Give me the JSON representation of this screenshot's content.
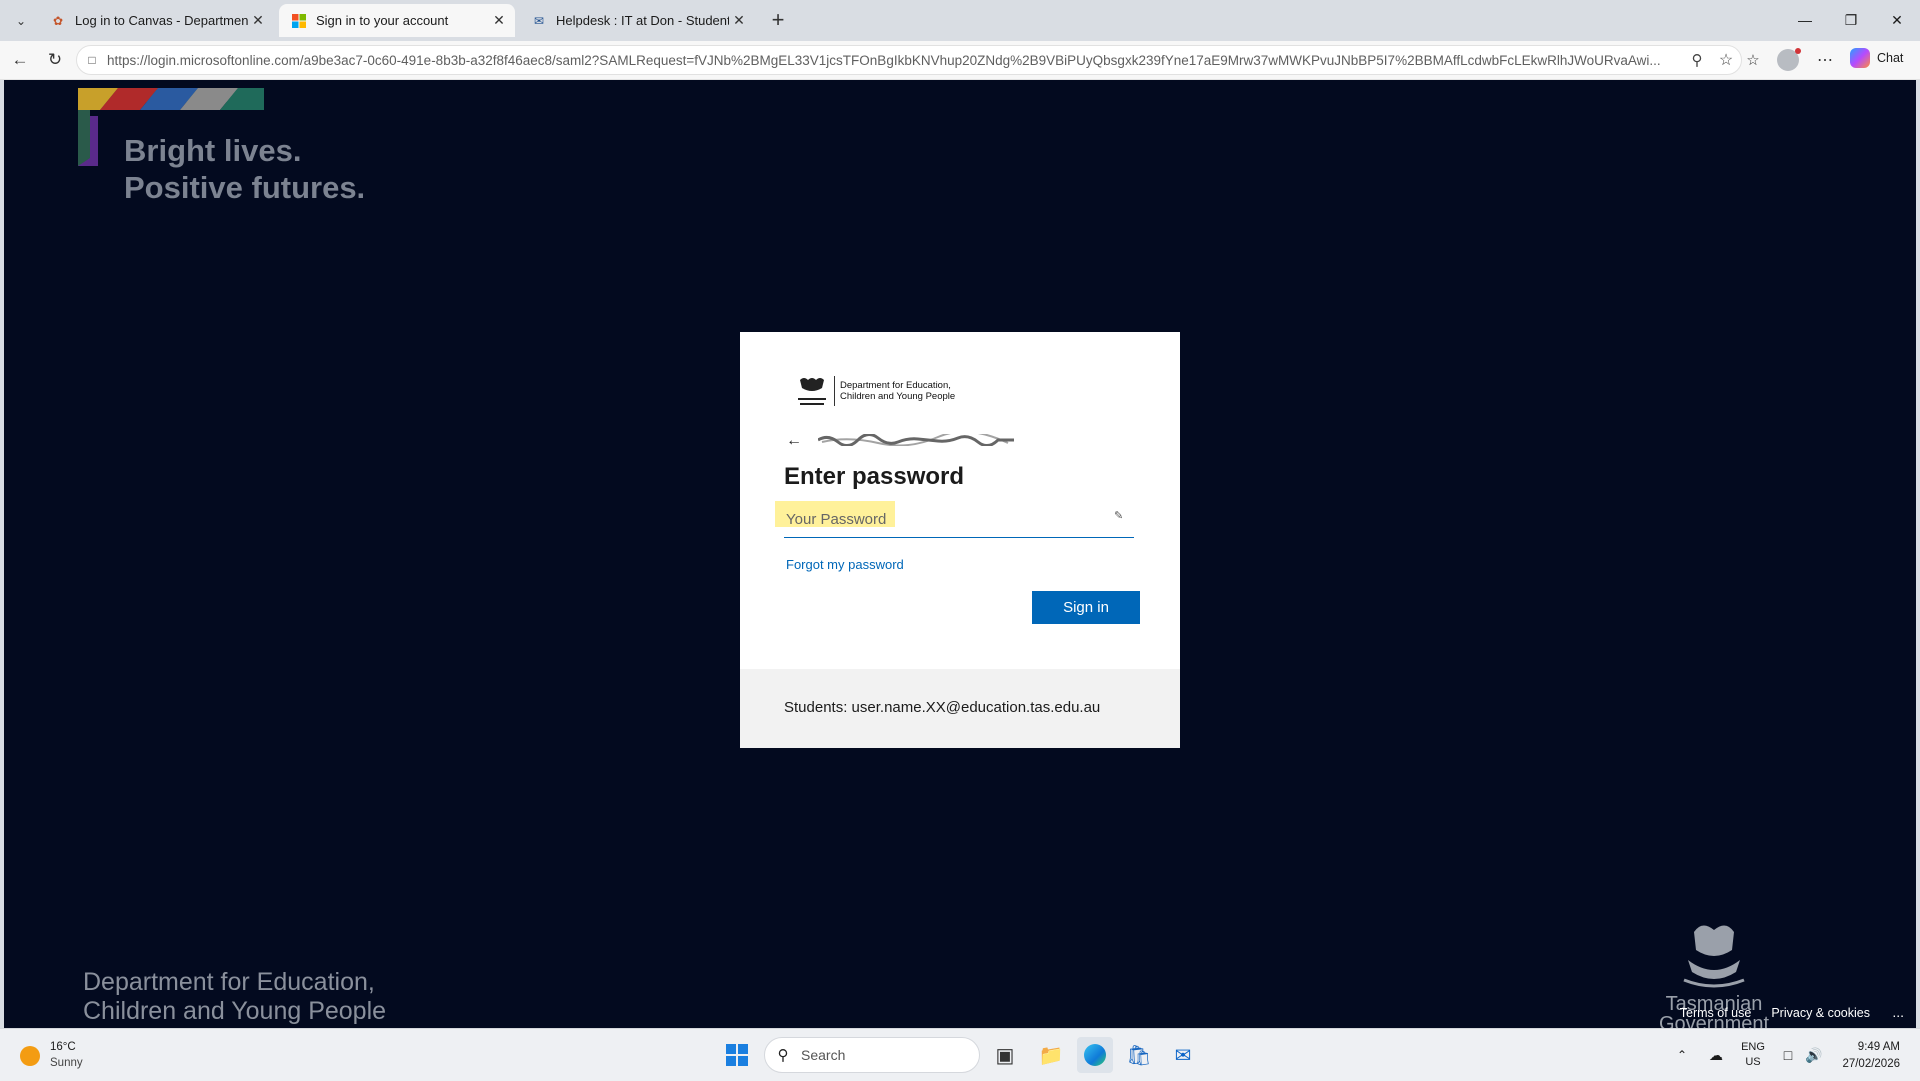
{
  "browser": {
    "tabs": [
      {
        "title": "Log in to Canvas - Department for Education, Children and Young People",
        "active": false
      },
      {
        "title": "Sign in to your account",
        "active": true
      },
      {
        "title": "Helpdesk : IT at Don - Student Operations",
        "active": false
      }
    ],
    "url": "https://login.microsoftonline.com/a9be3ac7-0c60-491e-8b3b-a32f8f46aec8/saml2?SAMLRequest=fVJNb%2BMgEL33V1jcsTFOnBgIkbKNVhup20ZNdg%2B9VBiPUyQbsgxk239fYne17aE9Mrw37wMWKPvuJNbBP5I7%2BBMAffLcdwbFcLEkwRlhJWoURvaAwi...",
    "chat_label": "Chat"
  },
  "page": {
    "tagline_line1": "Bright lives.",
    "tagline_line2": "Positive futures.",
    "dept_line1": "Department for Education,",
    "dept_line2": "Children and Young People",
    "tas_gov_line1": "Tasmanian",
    "tas_gov_line2": "Government",
    "footer": {
      "terms": "Terms of use",
      "privacy": "Privacy & cookies",
      "more": "..."
    }
  },
  "signin_card": {
    "org_line1": "Department for Education,",
    "org_line2": "Children and Young People",
    "heading": "Enter password",
    "password_placeholder": "Your Password",
    "forgot_link": "Forgot my password",
    "signin_button": "Sign in",
    "students_hint": "Students: user.name.XX@education.tas.edu.au",
    "accent_color": "#0067b8"
  },
  "taskbar": {
    "weather": {
      "temp": "16°C",
      "desc": "Sunny"
    },
    "search_placeholder": "Search",
    "language": {
      "line1": "ENG",
      "line2": "US"
    },
    "time": "9:49 AM",
    "date": "27/02/2026"
  }
}
